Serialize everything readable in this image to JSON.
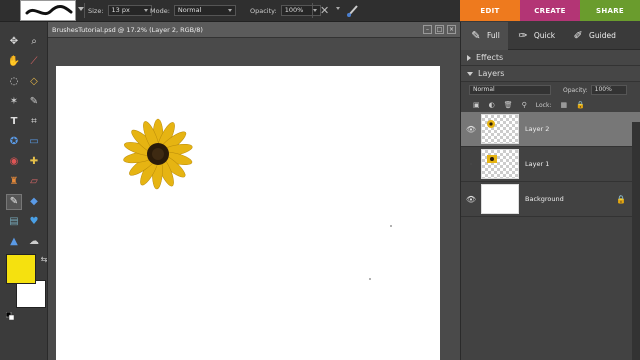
{
  "options_bar": {
    "size_label": "Size:",
    "size_value": "13 px",
    "mode_label": "Mode:",
    "mode_value": "Normal",
    "opacity_label": "Opacity:",
    "opacity_value": "100%"
  },
  "mode_tabs": [
    {
      "label": "EDIT",
      "color": "#ee7a1e"
    },
    {
      "label": "CREATE",
      "color": "#b33575"
    },
    {
      "label": "SHARE",
      "color": "#6a9c2d"
    }
  ],
  "document": {
    "title": "BrushesTutorial.psd @ 17.2% (Layer 2, RGB/8)"
  },
  "colors": {
    "foreground": "#f5e10f",
    "background": "#ffffff"
  },
  "panel": {
    "tabs": [
      {
        "label": "Full",
        "icon": "full-edit-icon"
      },
      {
        "label": "Quick",
        "icon": "quick-edit-icon"
      },
      {
        "label": "Guided",
        "icon": "guided-edit-icon"
      }
    ],
    "effects_title": "Effects",
    "layers_title": "Layers",
    "blend_mode": "Normal",
    "opacity_label": "Opacity:",
    "opacity_value": "100%",
    "lock_label": "Lock:",
    "layers": [
      {
        "name": "Layer 2",
        "selected": true
      },
      {
        "name": "Layer 1",
        "selected": false
      },
      {
        "name": "Background",
        "selected": false,
        "locked": true
      }
    ]
  }
}
